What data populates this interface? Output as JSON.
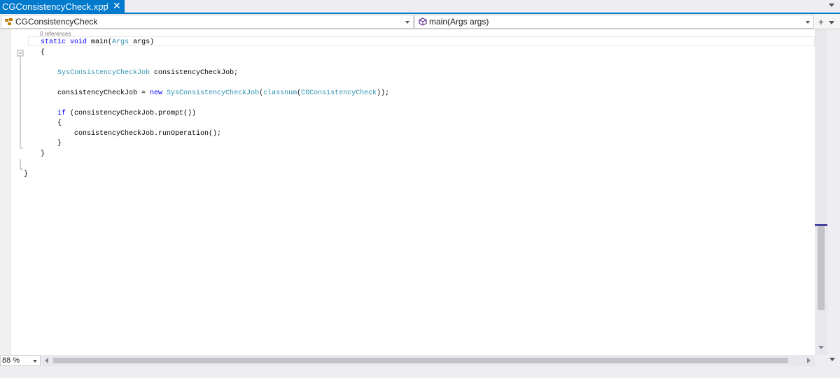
{
  "tab": {
    "title": "CGConsistencyCheck.xpp",
    "pin_glyph": "⊣",
    "close_glyph": "✕"
  },
  "nav": {
    "class_dropdown": "CGConsistencyCheck",
    "member_dropdown": "main(Args args)",
    "class_icon": "class-icon",
    "method_icon": "method-icon",
    "split_glyph": "+"
  },
  "code": {
    "codelens": "0 references",
    "lines": [
      [
        [
          "kw",
          "static "
        ],
        [
          "kw",
          "void "
        ],
        [
          "",
          "main("
        ],
        [
          "ty",
          "Args "
        ],
        [
          "",
          "args)"
        ]
      ],
      [
        [
          "",
          "{"
        ]
      ],
      [
        [
          "",
          ""
        ]
      ],
      [
        [
          "",
          "    "
        ],
        [
          "ty",
          "SysConsistencyCheckJob "
        ],
        [
          "",
          "consistencyCheckJob;"
        ]
      ],
      [
        [
          "",
          ""
        ]
      ],
      [
        [
          "",
          "    consistencyCheckJob = "
        ],
        [
          "kw",
          "new "
        ],
        [
          "ty",
          "SysConsistencyCheckJob"
        ],
        [
          "",
          "("
        ],
        [
          "ty",
          "classnum"
        ],
        [
          "",
          "("
        ],
        [
          "ty",
          "CGConsistencyCheck"
        ],
        [
          "",
          "));"
        ]
      ],
      [
        [
          "",
          ""
        ]
      ],
      [
        [
          "",
          "    "
        ],
        [
          "kw",
          "if "
        ],
        [
          "",
          "(consistencyCheckJob.prompt())"
        ]
      ],
      [
        [
          "",
          "    {"
        ]
      ],
      [
        [
          "",
          "        consistencyCheckJob.runOperation();"
        ]
      ],
      [
        [
          "",
          "    }"
        ]
      ],
      [
        [
          "",
          "}"
        ]
      ],
      [
        [
          "",
          ""
        ]
      ],
      [
        [
          "",
          "}"
        ]
      ]
    ]
  },
  "status": {
    "zoom": "88 %"
  },
  "colors": {
    "accent": "#007acc",
    "keyword": "#0000ff",
    "type": "#2b91af"
  }
}
